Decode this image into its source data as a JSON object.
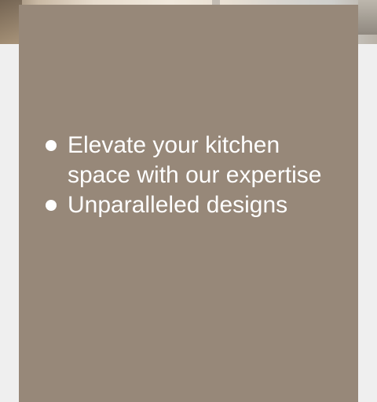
{
  "features": {
    "items": [
      {
        "text": "Elevate your kitchen space with our expertise"
      },
      {
        "text": "Unparalleled designs"
      }
    ]
  },
  "colors": {
    "card_background": "#978879",
    "page_background": "#efefef",
    "text": "#ffffff"
  },
  "icons": {
    "bullet": "bullet-dot-icon"
  }
}
